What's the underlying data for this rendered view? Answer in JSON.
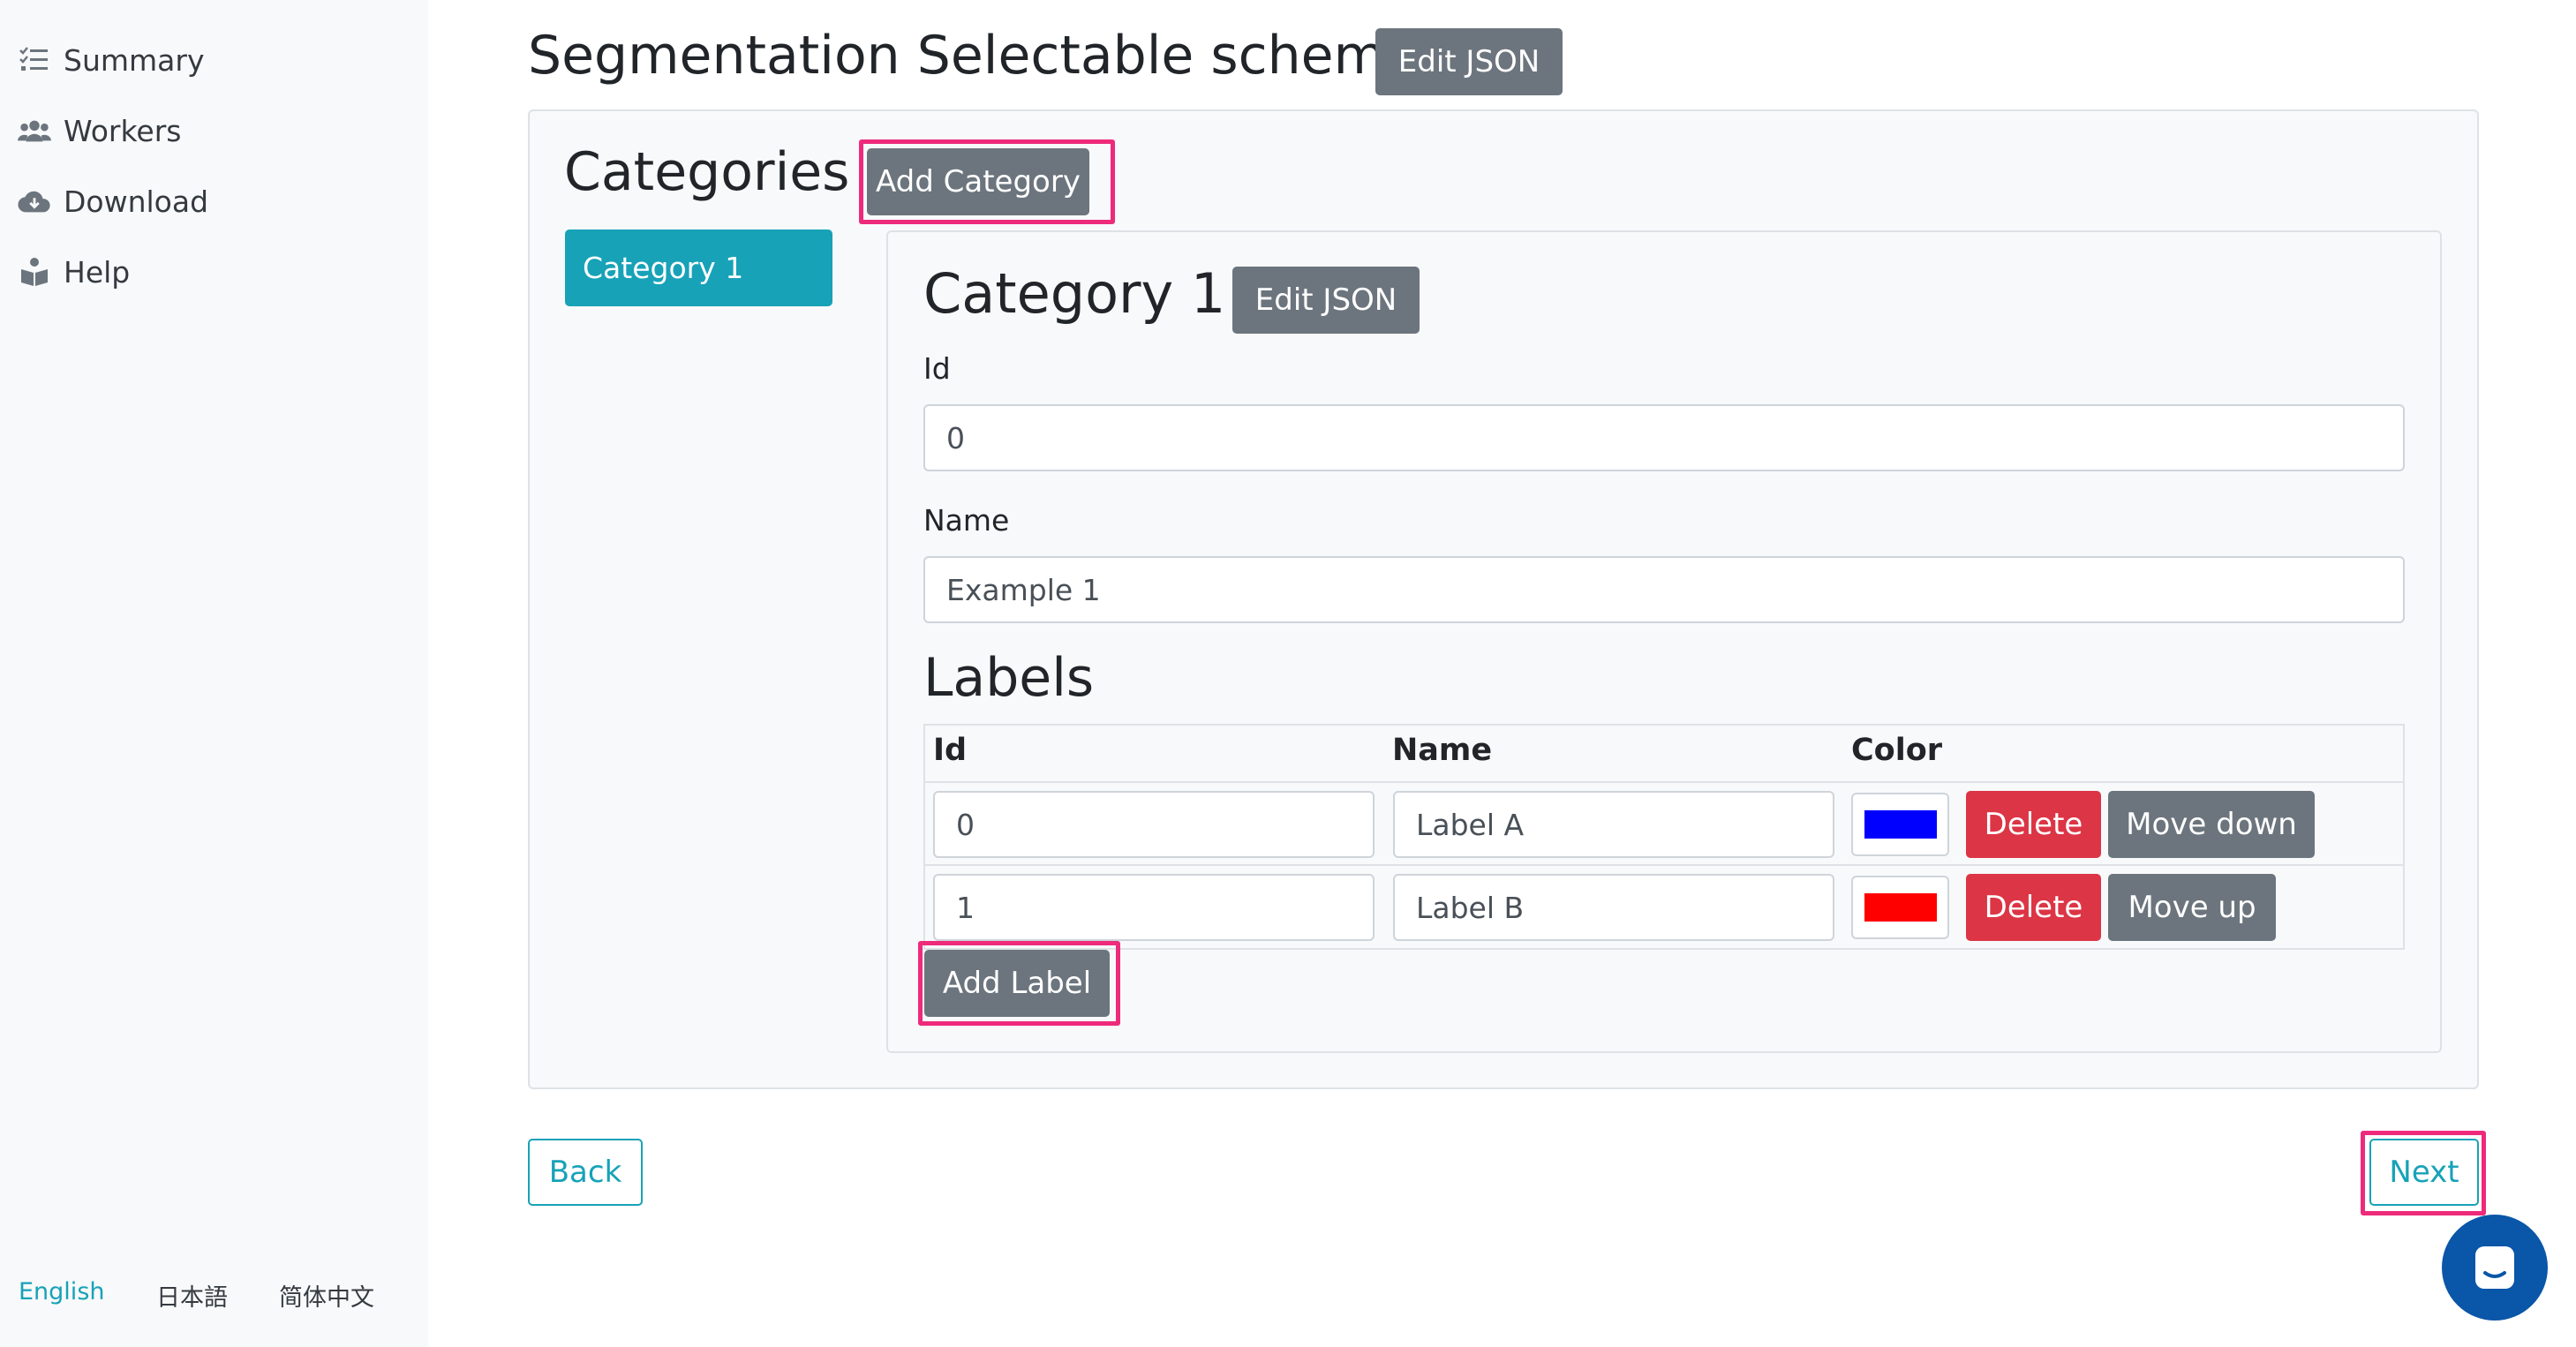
{
  "sidebar": {
    "items": [
      {
        "label": "Summary",
        "icon": "list-check-icon"
      },
      {
        "label": "Workers",
        "icon": "users-icon"
      },
      {
        "label": "Download",
        "icon": "cloud-download-icon"
      },
      {
        "label": "Help",
        "icon": "book-reader-icon"
      }
    ],
    "languages": [
      {
        "label": "English",
        "active": true
      },
      {
        "label": "日本語",
        "active": false
      },
      {
        "label": "简体中文",
        "active": false
      }
    ]
  },
  "header": {
    "title": "Segmentation Selectable schema",
    "edit_json_label": "Edit JSON"
  },
  "categories": {
    "title": "Categories",
    "add_category_label": "Add Category",
    "items": [
      "Category 1"
    ]
  },
  "category_detail": {
    "title": "Category 1",
    "edit_json_label": "Edit JSON",
    "id_label": "Id",
    "id_value": "0",
    "name_label": "Name",
    "name_value": "Example 1"
  },
  "labels": {
    "title": "Labels",
    "headers": [
      "Id",
      "Name",
      "Color"
    ],
    "rows": [
      {
        "id": "0",
        "name": "Label A",
        "color": "#0000ff",
        "delete_label": "Delete",
        "move_label": "Move down"
      },
      {
        "id": "1",
        "name": "Label B",
        "color": "#ff0000",
        "delete_label": "Delete",
        "move_label": "Move up"
      }
    ],
    "add_label": "Add Label"
  },
  "footer": {
    "back_label": "Back",
    "next_label": "Next"
  },
  "colors": {
    "accent": "#17a2b8",
    "secondary": "#6c757d",
    "danger": "#dc3545",
    "highlight": "#ee2a7b",
    "chat": "#0a56a8"
  }
}
